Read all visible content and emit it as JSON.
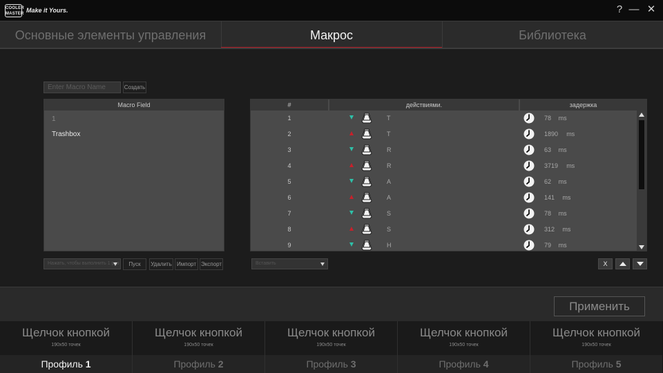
{
  "app": {
    "logo": "COOLER MASTER",
    "tagline": "Make it Yours."
  },
  "window_controls": {
    "help": "?",
    "minimize": "—",
    "close": "✕"
  },
  "tabs": [
    {
      "label": "Основные элементы управления",
      "active": false
    },
    {
      "label": "Макрос",
      "active": true
    },
    {
      "label": "Библиотека",
      "active": false
    }
  ],
  "macro": {
    "name_placeholder": "Enter Macro Name",
    "create_label": "Создать",
    "field_header": "Macro Field",
    "field_items": [
      "1",
      "Trashbox"
    ],
    "run_mode_placeholder": "Нажать, чтобы выполнить 1 раз",
    "play_label": "Пуск",
    "delete_label": "Удалить",
    "import_label": "Импорт",
    "export_label": "Экспорт"
  },
  "actions": {
    "headers": {
      "num": "#",
      "action": "действиями.",
      "delay": "задержка"
    },
    "unit": "ms",
    "rows": [
      {
        "num": "1",
        "dir": "down",
        "key": "T",
        "delay": "78"
      },
      {
        "num": "2",
        "dir": "up",
        "key": "T",
        "delay": "1890"
      },
      {
        "num": "3",
        "dir": "down",
        "key": "R",
        "delay": "63"
      },
      {
        "num": "4",
        "dir": "up",
        "key": "R",
        "delay": "3719"
      },
      {
        "num": "5",
        "dir": "down",
        "key": "A",
        "delay": "62"
      },
      {
        "num": "6",
        "dir": "up",
        "key": "A",
        "delay": "141"
      },
      {
        "num": "7",
        "dir": "down",
        "key": "S",
        "delay": "78"
      },
      {
        "num": "8",
        "dir": "up",
        "key": "S",
        "delay": "312"
      },
      {
        "num": "9",
        "dir": "down",
        "key": "H",
        "delay": "79"
      }
    ],
    "insert_placeholder": "Вставить",
    "x_label": "X",
    "colors": {
      "key_down": "#2ec0a8",
      "key_up": "#c8202a"
    }
  },
  "apply_label": "Применить",
  "profiles": [
    {
      "caption": "Щелчок кнопкой",
      "size": "190x50 точек",
      "name": "Профиль ",
      "index": "1",
      "active": true
    },
    {
      "caption": "Щелчок кнопкой",
      "size": "190x50 точек",
      "name": "Профиль ",
      "index": "2",
      "active": false
    },
    {
      "caption": "Щелчок кнопкой",
      "size": "190x50 точек",
      "name": "Профиль ",
      "index": "3",
      "active": false
    },
    {
      "caption": "Щелчок кнопкой",
      "size": "190x50 точек",
      "name": "Профиль ",
      "index": "4",
      "active": false
    },
    {
      "caption": "Щелчок кнопкой",
      "size": "190x50 точек",
      "name": "Профиль ",
      "index": "5",
      "active": false
    }
  ]
}
